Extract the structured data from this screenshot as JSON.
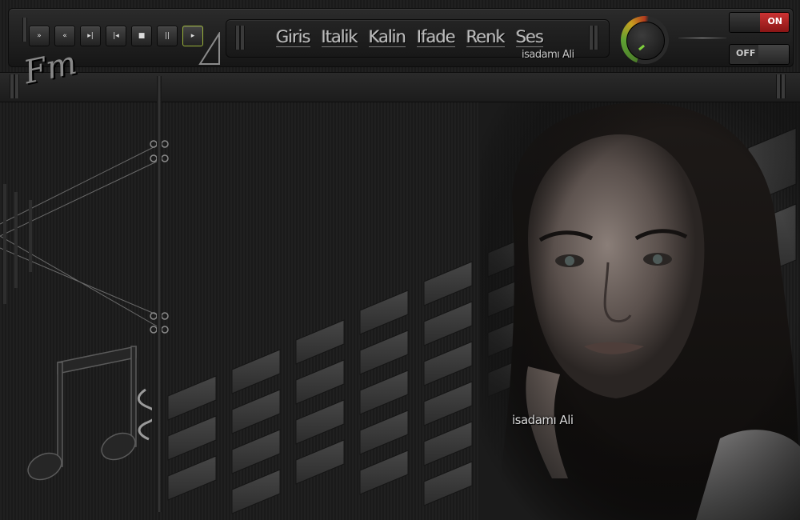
{
  "player": {
    "controls": [
      {
        "name": "fast-forward-button",
        "glyph": "»"
      },
      {
        "name": "rewind-button",
        "glyph": "«"
      },
      {
        "name": "next-track-button",
        "glyph": "▸|"
      },
      {
        "name": "previous-track-button",
        "glyph": "|◂"
      },
      {
        "name": "stop-button",
        "glyph": "■"
      },
      {
        "name": "pause-button",
        "glyph": "||"
      },
      {
        "name": "play-button",
        "glyph": "▸"
      }
    ]
  },
  "menu": {
    "items": [
      "Giris",
      "Italik",
      "Kalin",
      "Ifade",
      "Renk",
      "Ses"
    ]
  },
  "signature_top": "isadamı Ali",
  "logo_text": "Fm",
  "switches": {
    "on_label": "ON",
    "off_label": "OFF"
  },
  "signature_photo": "isadamı Ali",
  "colors": {
    "on_switch": "#c33333",
    "active_button_border": "#9ab33a",
    "knob_indicator": "#7fcf3d"
  },
  "icons": [
    "musical-note-icon",
    "treble-clef-icon",
    "volume-knob-icon"
  ]
}
